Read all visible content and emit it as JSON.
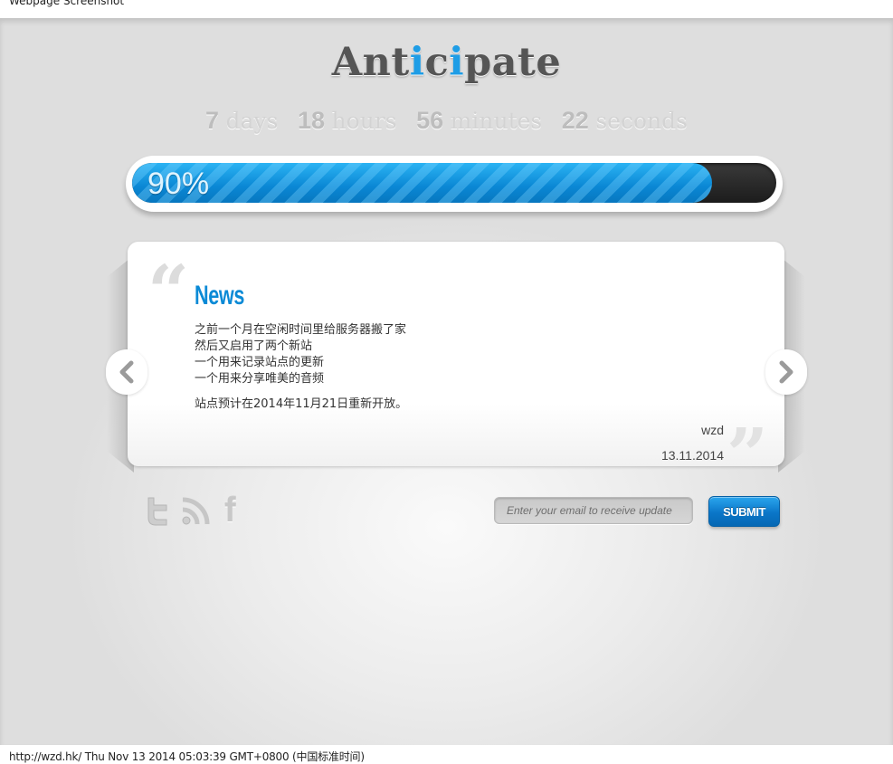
{
  "window": {
    "title": "Webpage Screenshot"
  },
  "header": {
    "logo_parts": [
      "Ant",
      "i",
      "c",
      "i",
      "pate"
    ],
    "logo_text": "Anticipate",
    "accent_color": "#1e9de6"
  },
  "countdown": {
    "days": {
      "value": "7",
      "unit": "days"
    },
    "hours": {
      "value": "18",
      "unit": "hours"
    },
    "minutes": {
      "value": "56",
      "unit": "minutes"
    },
    "seconds": {
      "value": "22",
      "unit": "seconds"
    }
  },
  "progress": {
    "percent": 90,
    "label": "90%"
  },
  "news": {
    "title": "News",
    "lines": [
      "之前一个月在空闲时间里给服务器搬了家",
      "然后又启用了两个新站",
      "一个用来记录站点的更新",
      "一个用来分享唯美的音频"
    ],
    "paragraph": "站点预计在2014年11月21日重新开放。",
    "author": "wzd",
    "date": "13.11.2014",
    "prev_icon": "chevron-left-icon",
    "next_icon": "chevron-right-icon",
    "open_quote": "“",
    "close_quote": "”"
  },
  "social": {
    "twitter": "twitter-icon",
    "rss": "rss-icon",
    "facebook": "facebook-icon",
    "facebook_glyph": "f"
  },
  "subscribe": {
    "placeholder": "Enter your email to receive update",
    "value": "",
    "submit_label": "SUBMIT"
  },
  "statusbar": {
    "text": "http://wzd.hk/ Thu Nov 13 2014 05:03:39 GMT+0800 (中国标准时间)"
  }
}
